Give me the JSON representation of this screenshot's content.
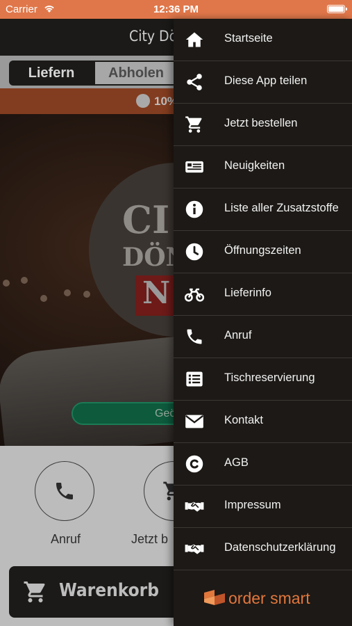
{
  "status_bar": {
    "carrier": "Carrier",
    "time": "12:36 PM"
  },
  "app": {
    "header_title": "City Dö",
    "tabs": [
      {
        "label": "Liefern"
      },
      {
        "label": "Abholen"
      }
    ],
    "promo_text": "10%",
    "hero": {
      "logo_line1": "CI",
      "logo_line2": "DÖN",
      "logo_line3": "N",
      "open_button": "Geö"
    },
    "actions": [
      {
        "label": "Anruf"
      },
      {
        "label": "Jetzt b"
      }
    ],
    "cart_label": "Warenkorb"
  },
  "drawer": {
    "items": [
      {
        "label": "Startseite",
        "icon": "home-icon"
      },
      {
        "label": "Diese App teilen",
        "icon": "share-icon"
      },
      {
        "label": "Jetzt bestellen",
        "icon": "cart-icon"
      },
      {
        "label": "Neuigkeiten",
        "icon": "news-icon"
      },
      {
        "label": "Liste aller Zusatzstoffe",
        "icon": "info-icon"
      },
      {
        "label": "Öffnungszeiten",
        "icon": "clock-icon"
      },
      {
        "label": "Lieferinfo",
        "icon": "motorcycle-icon"
      },
      {
        "label": "Anruf",
        "icon": "phone-icon"
      },
      {
        "label": "Tischreservierung",
        "icon": "list-icon"
      },
      {
        "label": "Kontakt",
        "icon": "envelope-icon"
      },
      {
        "label": "AGB",
        "icon": "copyright-icon"
      },
      {
        "label": "Impressum",
        "icon": "handshake-icon"
      },
      {
        "label": "Datenschutzerklärung",
        "icon": "handshake-icon"
      }
    ],
    "brand": "order smart"
  },
  "colors": {
    "status_bar": "#e0774a",
    "drawer_bg": "#1c1916",
    "brand": "#e2773c",
    "open_button": "#0d5a3d"
  }
}
